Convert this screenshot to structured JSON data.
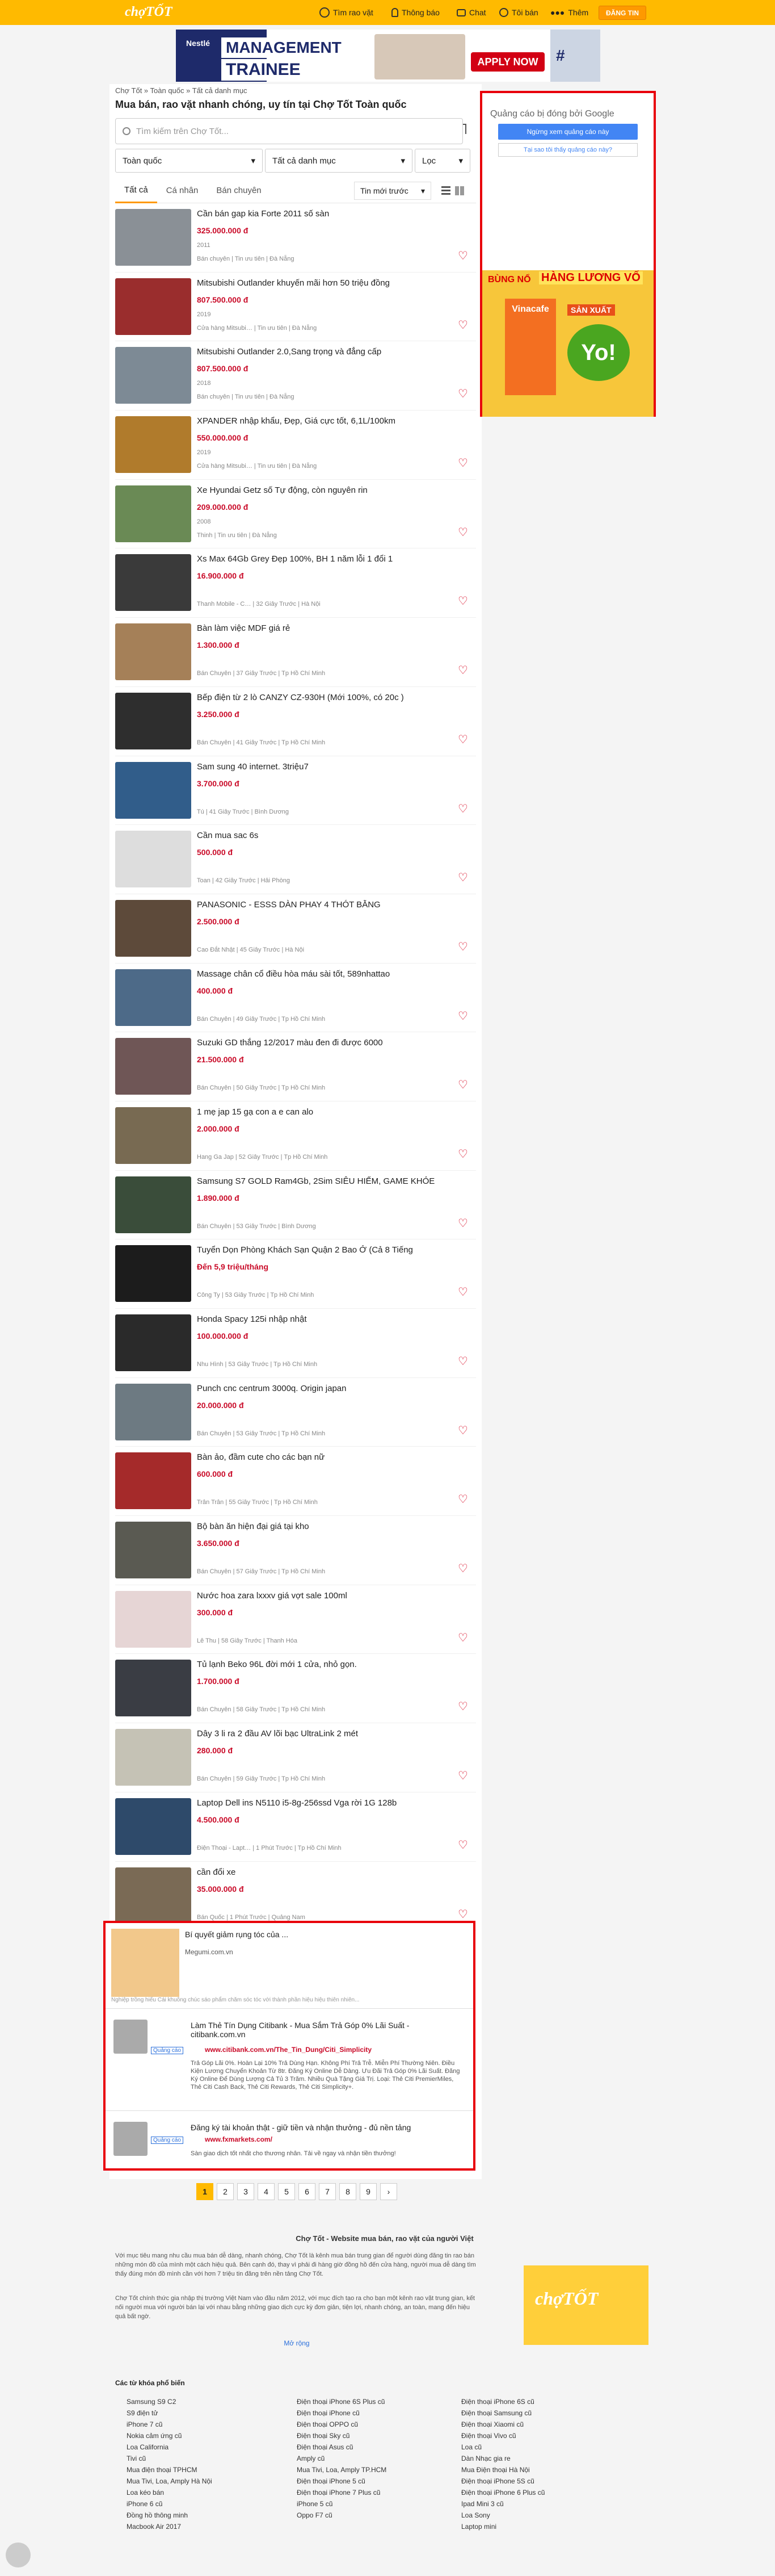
{
  "header": {
    "logo": "chợTỐT",
    "search_label": "Tìm rao vặt",
    "notify_label": "Thông báo",
    "chat_label": "Chat",
    "me_label": "Tôi bán",
    "more_label": "Thêm",
    "register": "ĐĂNG TIN"
  },
  "banner": {
    "brand": "Nestlé",
    "title1": "MANAGEMENT",
    "title2": "TRAINEE",
    "cta": "APPLY NOW",
    "tag": "#"
  },
  "breadcrumb": "Chợ Tốt » Toàn quốc » Tất cả danh mục",
  "page_title": "Mua bán, rao vặt nhanh chóng, uy tín tại Chợ Tốt Toàn quốc",
  "search": {
    "placeholder": "Tìm kiếm trên Chợ Tốt..."
  },
  "filters": {
    "region": "Toàn quốc",
    "category": "Tất cả danh mục",
    "filter": "Lọc"
  },
  "tabs": [
    "Tất cả",
    "Cá nhân",
    "Bán chuyên"
  ],
  "sort": "Tin mới trước",
  "items": [
    {
      "t": "Cần bán gap kia Forte 2011 số sàn",
      "p": "325.000.000 đ",
      "y": "2011",
      "m": "Bán chuyên  |  Tin ưu tiên  |  Đà Nẵng",
      "c": "#8a9096"
    },
    {
      "t": "Mitsubishi Outlander khuyến mãi hơn 50 triệu đồng",
      "p": "807.500.000 đ",
      "y": "2019",
      "m": "Cửa hàng Mitsubi…  |  Tin ưu tiên  |  Đà Nẵng",
      "c": "#9a2d2d"
    },
    {
      "t": "Mitsubishi Outlander 2.0,Sang trọng và đẳng cấp",
      "p": "807.500.000 đ",
      "y": "2018",
      "m": "Bán chuyên  |  Tin ưu tiên  |  Đà Nẵng",
      "c": "#7d8a95"
    },
    {
      "t": "XPANDER nhập khẩu, Đẹp, Giá cực tốt, 6,1L/100km",
      "p": "550.000.000 đ",
      "y": "2019",
      "m": "Cửa hàng Mitsubi…  |  Tin ưu tiên  |  Đà Nẵng",
      "c": "#b07b2c"
    },
    {
      "t": "Xe Hyundai Getz số Tự động, còn nguyên rin",
      "p": "209.000.000 đ",
      "y": "2008",
      "m": "Thinh  |  Tin ưu tiên  |  Đà Nẵng",
      "c": "#6a8a55"
    },
    {
      "t": "Xs Max 64Gb Grey Đẹp 100%, BH 1 năm lỗi 1 đổi 1",
      "p": "16.900.000 đ",
      "y": "",
      "m": "Thanh Mobile - C…  |  32 Giây Trước  |  Hà Nội",
      "c": "#3a3a3a"
    },
    {
      "t": "Bàn làm việc MDF giá rẻ",
      "p": "1.300.000 đ",
      "y": "",
      "m": "Bán Chuyên  |  37 Giây Trước  |  Tp Hồ Chí Minh",
      "c": "#a58058"
    },
    {
      "t": "Bếp điện từ 2 lò CANZY CZ-930H (Mới 100%, có 20c )",
      "p": "3.250.000 đ",
      "y": "",
      "m": "Bán Chuyên  |  41 Giây Trước  |  Tp Hồ Chí Minh",
      "c": "#2e2e2e"
    },
    {
      "t": "Sam sung 40 internet. 3triệu7",
      "p": "3.700.000 đ",
      "y": "",
      "m": "Tú  |  41 Giây Trước  |  Bình Dương",
      "c": "#315d8a"
    },
    {
      "t": "Cần mua sac 6s",
      "p": "500.000 đ",
      "y": "",
      "m": "Toan  |  42 Giây Trước  |  Hải Phòng",
      "c": "#dddddd"
    },
    {
      "t": "PANASONIC - ESSS DÀN PHAY 4 THÓT BẰNG",
      "p": "2.500.000 đ",
      "y": "",
      "m": "Cao Đắt Nhật  |  45 Giây Trước  |  Hà Nội",
      "c": "#5d4a3a"
    },
    {
      "t": "Massage chân cổ điều hòa máu sài tốt, 589nhattao",
      "p": "400.000 đ",
      "y": "",
      "m": "Bán Chuyên  |  49 Giây Trước  |  Tp Hồ Chí Minh",
      "c": "#4d6a88"
    },
    {
      "t": "Suzuki GD thắng 12/2017 màu đen đi được 6000",
      "p": "21.500.000 đ",
      "y": "",
      "m": "Bán Chuyên  |  50 Giây Trước  |  Tp Hồ Chí Minh",
      "c": "#6f5656"
    },
    {
      "t": "1 mẹ jap 15 gạ con a e can alo",
      "p": "2.000.000 đ",
      "y": "",
      "m": "Hang Ga Jap  |  52 Giây Trước  |  Tp Hồ Chí Minh",
      "c": "#786a52"
    },
    {
      "t": "Samsung S7 GOLD Ram4Gb, 2Sim SIÊU HIẾM, GAME KHỎE",
      "p": "1.890.000 đ",
      "y": "",
      "m": "Bán Chuyên  |  53 Giây Trước  |  Bình Dương",
      "c": "#3a4d3a"
    },
    {
      "t": "Tuyển Dọn Phòng Khách Sạn Quận 2 Bao Ở (Cả 8 Tiếng",
      "p": "Đến 5,9 triệu/tháng",
      "y": "",
      "m": "Công Ty  |  53 Giây Trước  |  Tp Hồ Chí Minh",
      "c": "#1c1c1c"
    },
    {
      "t": "Honda Spacy 125i nhập nhật",
      "p": "100.000.000 đ",
      "y": "",
      "m": "Nhu Hình  |  53 Giây Trước  |  Tp Hồ Chí Minh",
      "c": "#2a2a2a"
    },
    {
      "t": "Punch cnc centrum 3000q. Origin japan",
      "p": "20.000.000 đ",
      "y": "",
      "m": "Bán Chuyên  |  53 Giây Trước  |  Tp Hồ Chí Minh",
      "c": "#6d7a82"
    },
    {
      "t": "Bàn ảo, đầm cute cho các bạn nữ",
      "p": "600.000 đ",
      "y": "",
      "m": "Trân Trân  |  55 Giây Trước  |  Tp Hồ Chí Minh",
      "c": "#a52a2a"
    },
    {
      "t": "Bộ bàn ăn hiện đại giá tại kho",
      "p": "3.650.000 đ",
      "y": "",
      "m": "Bán Chuyên  |  57 Giây Trước  |  Tp Hồ Chí Minh",
      "c": "#5a5a52"
    },
    {
      "t": "Nước hoa zara lxxxv giá vợt sale 100ml",
      "p": "300.000 đ",
      "y": "",
      "m": "Lê Thu  |  58 Giây Trước  |  Thanh Hóa",
      "c": "#e6d5d5"
    },
    {
      "t": "Tủ lạnh Beko 96L đời mới 1 cửa, nhỏ gọn.",
      "p": "1.700.000 đ",
      "y": "",
      "m": "Bán Chuyên  |  58 Giây Trước  |  Tp Hồ Chí Minh",
      "c": "#3a3d44"
    },
    {
      "t": "Dây 3 li ra 2 đầu AV lõi bạc UltraLink 2 mét",
      "p": "280.000 đ",
      "y": "",
      "m": "Bán Chuyên  |  59 Giây Trước  |  Tp Hồ Chí Minh",
      "c": "#c5c2b5"
    },
    {
      "t": "Laptop Dell ins N5110 i5-8g-256ssd Vga rời 1G 128b",
      "p": "4.500.000 đ",
      "y": "",
      "m": "Điện Thoại - Lapt…  |  1 Phút Trước  |  Tp Hồ Chí Minh",
      "c": "#2e4a6a"
    },
    {
      "t": "cần đổi xe",
      "p": "35.000.000 đ",
      "y": "",
      "m": "Bán Quốc  |  1 Phút Trước  |  Quảng Nam",
      "c": "#7a6a55"
    }
  ],
  "right_ad": {
    "label": "Quảng cáo bị đóng bởi Google",
    "btn": "Ngừng xem quảng cáo này",
    "why": "Tại sao tôi thấy quảng cáo này?",
    "brand": "Vinacafe",
    "p1": "BÙNG NỔ",
    "p2": "HÀNG LƯƠNG VỐ",
    "p3": "SẢN XUẤT",
    "p4": "Yo!"
  },
  "native_ads": [
    {
      "title": "Bí quyết giảm rụng tóc của ...",
      "url": "Megumi.com.vn",
      "desc": "Nghiệp trồng hiếu Cái khuông chúc sáo phẩm chăm sóc tóc với thành phần hiệu hiệu thiên nhiên..."
    },
    {
      "title": "Làm Thẻ Tín Dụng Citibank - Mua Sắm Trả Góp 0% Lãi Suất - citibank.com.vn",
      "badge": "Quảng cáo",
      "url": "www.citibank.com.vn/The_Tin_Dung/Citi_Simplicity",
      "desc": "Trả Góp Lãi 0%. Hoàn Lại 10% Trả Dùng Hạn. Không Phí Trả Trễ. Miễn Phí Thường Niên. Điều Kiện Lương Chuyển Khoản Từ 8tr. Đăng Ký Online Dễ Dàng. Ưu Đãi Trả Góp 0% Lãi Suất. Đăng Ký Online Để Dùng Lượng Cả Tủ 3 Trăm. Nhiều Quà Tặng Giá Trị. Loại: Thẻ Citi PremierMiles, Thẻ Citi Cash Back, Thẻ Citi Rewards, Thẻ Citi Simplicity+."
    },
    {
      "title": "Đăng ký tài khoản thật - giữ tiền và nhận thưởng - đủ nền tảng",
      "badge": "Quảng cáo",
      "url": "www.fxmarkets.com/",
      "desc": "Sàn giao dịch tốt nhất cho thương nhân. Tải về ngay và nhận tiền thưởng!"
    }
  ],
  "pagination": [
    "1",
    "2",
    "3",
    "4",
    "5",
    "6",
    "7",
    "8",
    "9",
    "›"
  ],
  "seo": {
    "title": "Chợ Tốt - Website mua bán, rao vặt của người Việt",
    "p1": "Với mục tiêu mang nhu cầu mua bán dễ dàng, nhanh chóng, Chợ Tốt là kênh mua bán trung gian để người dùng đăng tin rao bán những món đồ của mình một cách hiệu quả. Bên cạnh đó, thay vì phải đi hàng giờ đồng hồ đến cửa hàng, người mua dễ dàng tìm thấy đúng món đồ mình cần với hơn 7 triệu tin đăng trên nền tảng Chợ Tốt.",
    "p2": "Chợ Tốt chính thức gia nhập thị trường Việt Nam vào đầu năm 2012, với mục đích tạo ra cho bạn một kênh rao vặt trung gian, kết nối người mua với người bán lại với nhau bằng những giao dịch cực kỳ đơn giản, tiện lợi, nhanh chóng, an toàn, mang đến hiệu quả bất ngờ.",
    "more": "Mở rộng"
  },
  "footer": {
    "title": "Các từ khóa phổ biến",
    "col1": [
      "Samsung S9 C2",
      "S9 điện tử",
      "iPhone 7 cũ",
      "Nokia cảm ứng cũ",
      "Loa California",
      "Tivi cũ",
      "Mua điện thoại TPHCM",
      "Mua Tivi, Loa, Amply Hà Nội",
      "Loa kéo bán",
      "iPhone 6 cũ",
      "Đồng hồ thông minh",
      "Macbook Air 2017"
    ],
    "col2": [
      "Điện thoại iPhone 6S Plus cũ",
      "Điện thoại iPhone cũ",
      "Điện thoại OPPO cũ",
      "Điện thoại Sky cũ",
      "Điện thoại Asus cũ",
      "Amply cũ",
      "Mua Tivi, Loa, Amply TP.HCM",
      "Điện thoại iPhone 5 cũ",
      "Điện thoại iPhone 7 Plus cũ",
      "iPhone 5 cũ",
      "Oppo F7 cũ"
    ],
    "col3": [
      "Điện thoại iPhone 6S cũ",
      "Điện thoại Samsung cũ",
      "Điện thoại Xiaomi cũ",
      "Điện thoại Vivo cũ",
      "Loa cũ",
      "Dàn Nhạc gia re",
      "Mua Điện thoại Hà Nội",
      "Điện thoại iPhone 5S cũ",
      "Điện thoại iPhone 6 Plus cũ",
      "Ipad Mini 3 cũ",
      "Loa Sony",
      "Laptop mini"
    ]
  },
  "colors": {
    "brand": "#ffba00",
    "price": "#c90927",
    "ad_border": "#e8000b"
  }
}
